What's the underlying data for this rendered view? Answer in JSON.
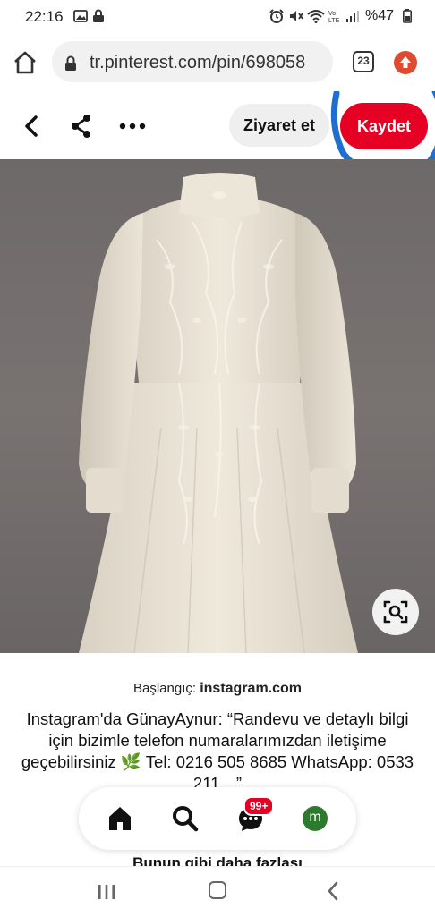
{
  "status_bar": {
    "time": "22:16",
    "battery": "%47"
  },
  "browser": {
    "url": "tr.pinterest.com/pin/698058",
    "tab_count": "23"
  },
  "pin_header": {
    "visit_label": "Ziyaret et",
    "save_label": "Kaydet"
  },
  "content": {
    "source_prefix": "Başlangıç:",
    "source_domain": "instagram.com",
    "description": "Instagram'da GünayAynur: “Randevu ve detaylı bilgi için bizimle telefon numaralarımızdan iletişime geçebilirsiniz 🌿 Tel: 0216 505 8685 WhatsApp: 0533 211…”",
    "more_like_this": "Bunun gibi daha fazlası"
  },
  "bottom_nav": {
    "badge": "99+",
    "avatar_letter": "m"
  },
  "colors": {
    "brand_red": "#e60023",
    "highlight_circle": "#1e6fd0"
  }
}
